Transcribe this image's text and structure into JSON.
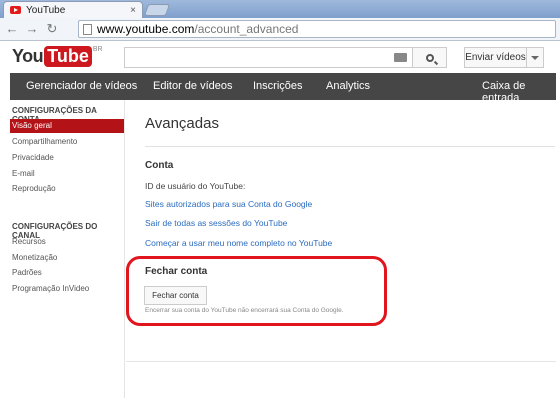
{
  "browser": {
    "tab_title": "YouTube",
    "tab_close": "×",
    "back": "←",
    "forward": "→",
    "reload": "↻",
    "url_domain": "www.youtube.com",
    "url_path": "/account_advanced"
  },
  "header": {
    "logo_you": "You",
    "logo_tube": "Tube",
    "logo_region": "BR",
    "upload_label": "Enviar vídeos"
  },
  "nav": {
    "items": [
      "Gerenciador de vídeos",
      "Editor de vídeos",
      "Inscrições",
      "Analytics",
      "Caixa de entrada"
    ]
  },
  "sidebar": {
    "account_heading": "CONFIGURAÇÕES DA CONTA",
    "account_items": [
      "Visão geral",
      "Compartilhamento",
      "Privacidade",
      "E-mail",
      "Reprodução"
    ],
    "channel_heading": "CONFIGURAÇÕES DO CANAL",
    "channel_items": [
      "Recursos",
      "Monetização",
      "Padrões",
      "Programação InVideo"
    ]
  },
  "main": {
    "title": "Avançadas",
    "account_section": "Conta",
    "user_id_label": "ID de usuário do YouTube:",
    "links": [
      "Sites autorizados para sua Conta do Google",
      "Sair de todas as sessões do YouTube",
      "Começar a usar meu nome completo no YouTube"
    ],
    "close_section": "Fechar conta",
    "close_button": "Fechar conta",
    "close_note": "Encerrar sua conta do YouTube não encerrará sua Conta do Google."
  },
  "colors": {
    "accent": "#b31217",
    "annotation": "#e0151d",
    "link": "#2a6bbf",
    "nav_bg": "#464646"
  }
}
